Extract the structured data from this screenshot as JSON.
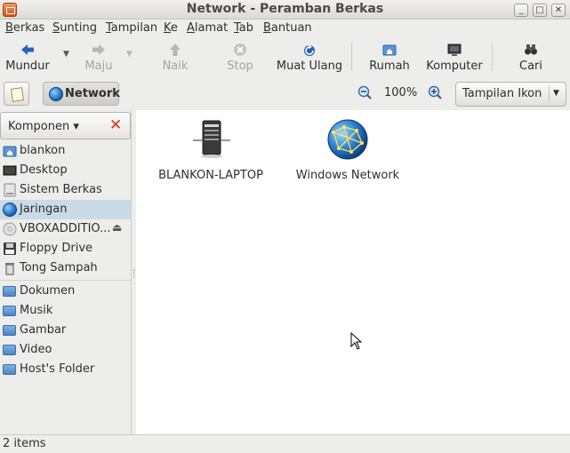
{
  "window": {
    "title": "Network - Peramban Berkas",
    "controls": {
      "minimize": "_",
      "maximize": "□",
      "close": "✕"
    }
  },
  "menu": [
    "Berkas",
    "Sunting",
    "Tampilan",
    "Ke",
    "Alamat",
    "Tab",
    "Bantuan"
  ],
  "toolbar": {
    "back": "Mundur",
    "forward": "Maju",
    "up": "Naik",
    "stop": "Stop",
    "reload": "Muat Ulang",
    "home": "Rumah",
    "computer": "Komputer",
    "search": "Cari"
  },
  "location": {
    "crumb": "Network",
    "zoom": "100%",
    "view_mode": "Tampilan Ikon"
  },
  "sidebar": {
    "header": "Komponen",
    "places": [
      {
        "label": "blankon",
        "icon": "home-icon"
      },
      {
        "label": "Desktop",
        "icon": "desktop-icon"
      },
      {
        "label": "Sistem Berkas",
        "icon": "harddisk-icon"
      },
      {
        "label": "Jaringan",
        "icon": "network-icon",
        "selected": true
      },
      {
        "label": "VBOXADDITIO...",
        "icon": "cdrom-icon",
        "eject": true
      },
      {
        "label": "Floppy Drive",
        "icon": "floppy-icon"
      },
      {
        "label": "Tong Sampah",
        "icon": "trash-icon"
      }
    ],
    "bookmarks": [
      {
        "label": "Dokumen",
        "icon": "folder-icon"
      },
      {
        "label": "Musik",
        "icon": "folder-icon"
      },
      {
        "label": "Gambar",
        "icon": "folder-icon"
      },
      {
        "label": "Video",
        "icon": "folder-icon"
      },
      {
        "label": "Host's Folder",
        "icon": "folder-icon"
      }
    ]
  },
  "content": {
    "items": [
      {
        "label": "BLANKON-LAPTOP",
        "icon": "computer-server-icon"
      },
      {
        "label": "Windows Network",
        "icon": "network-globe-icon"
      }
    ]
  },
  "status": {
    "text": "2 items"
  },
  "colors": {
    "selection": "#c9dbe6",
    "accent_blue": "#1f6fc2",
    "close_red": "#d9311e"
  }
}
